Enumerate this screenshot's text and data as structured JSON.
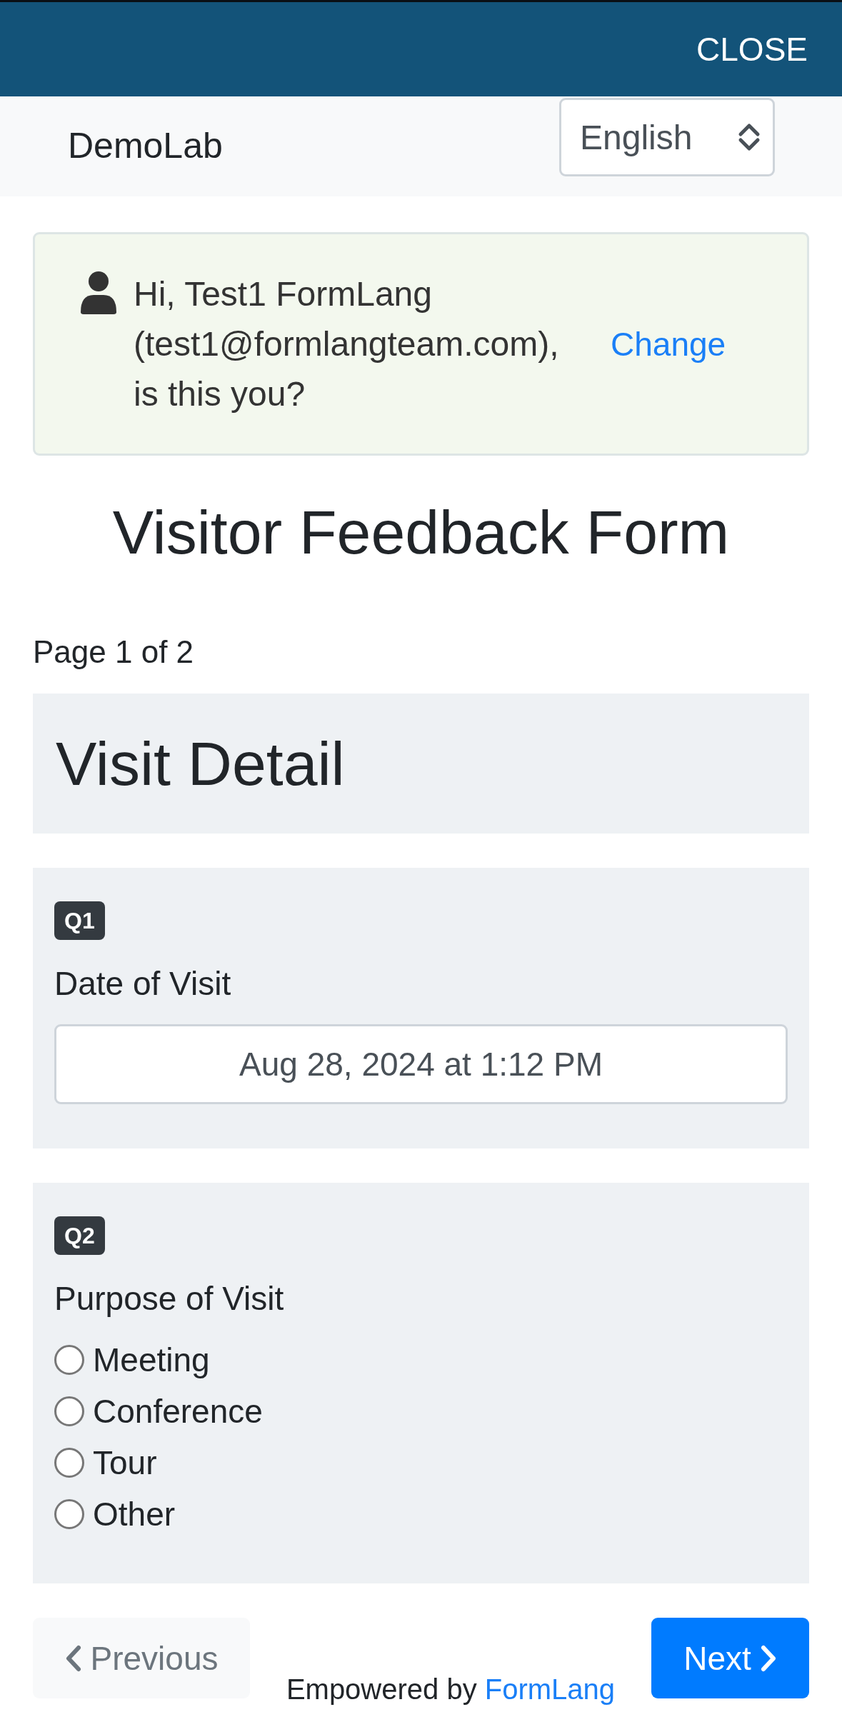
{
  "top_bar": {
    "close": "CLOSE"
  },
  "header": {
    "brand": "DemoLab",
    "language": "English"
  },
  "greeting": {
    "text": "Hi, Test1 FormLang (test1@formlangteam.com), is this you?",
    "change": "Change"
  },
  "title": "Visitor Feedback Form",
  "page_indicator": "Page 1 of 2",
  "section": "Visit Detail",
  "questions": [
    {
      "kind": "datetime",
      "number": "Q1",
      "label": "Date of Visit",
      "value": "Aug 28, 2024 at 1:12 PM"
    },
    {
      "kind": "radio",
      "number": "Q2",
      "label": "Purpose of Visit",
      "options": [
        {
          "label": "Meeting",
          "selected": false
        },
        {
          "label": "Conference",
          "selected": false
        },
        {
          "label": "Tour",
          "selected": false
        },
        {
          "label": "Other",
          "selected": false
        }
      ]
    }
  ],
  "nav": {
    "previous": {
      "label": "Previous",
      "disabled": true
    },
    "next": {
      "label": "Next",
      "disabled": false
    }
  },
  "footer": {
    "text": "Empowered by",
    "link": "FormLang"
  }
}
